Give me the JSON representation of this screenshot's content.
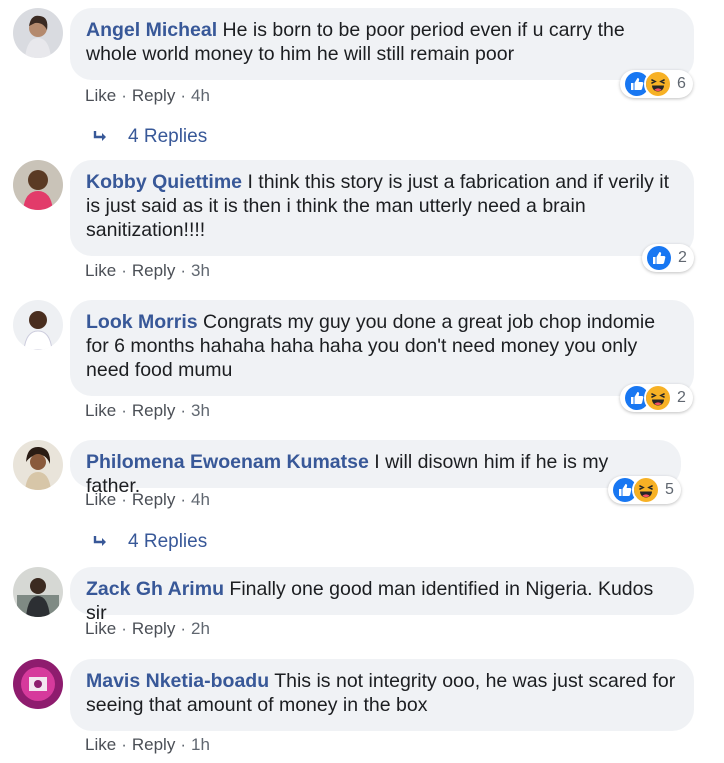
{
  "comments": [
    {
      "author": "Angel Micheal",
      "text": "He is born to be poor period even if u carry the whole world money to him he will still remain poor",
      "like": "Like",
      "reply": "Reply",
      "time": "4h",
      "reaction_count": "6",
      "reactions": [
        "like-icon",
        "haha-icon"
      ],
      "replies": "4 Replies"
    },
    {
      "author": "Kobby Quiettime",
      "text": "I think this story is just a fabrication and if verily it is just said as it is then i think the man utterly need a brain sanitization!!!!",
      "like": "Like",
      "reply": "Reply",
      "time": "3h",
      "reaction_count": "2",
      "reactions": [
        "like-icon"
      ]
    },
    {
      "author": "Look Morris",
      "text": "Congrats my guy you done a great job chop indomie for 6 months hahaha haha haha you don't need money you only need food mumu",
      "like": "Like",
      "reply": "Reply",
      "time": "3h",
      "reaction_count": "2",
      "reactions": [
        "like-icon",
        "haha-icon"
      ]
    },
    {
      "author": "Philomena Ewoenam Kumatse",
      "text": "I will disown him if he is my father.",
      "like": "Like",
      "reply": "Reply",
      "time": "4h",
      "reaction_count": "5",
      "reactions": [
        "like-icon",
        "haha-icon"
      ],
      "replies": "4 Replies"
    },
    {
      "author": "Zack Gh Arimu",
      "text": "Finally one good man identified in Nigeria. Kudos sir",
      "like": "Like",
      "reply": "Reply",
      "time": "2h"
    },
    {
      "author": "Mavis Nketia-boadu",
      "text": "This is not integrity ooo, he was just scared for seeing that amount of money in the box",
      "like": "Like",
      "reply": "Reply",
      "time": "1h"
    }
  ],
  "colors": {
    "author": "#385898",
    "bubble": "#f0f2f5",
    "like_blue": "#1877f2",
    "haha_yellow": "#f7b125"
  }
}
